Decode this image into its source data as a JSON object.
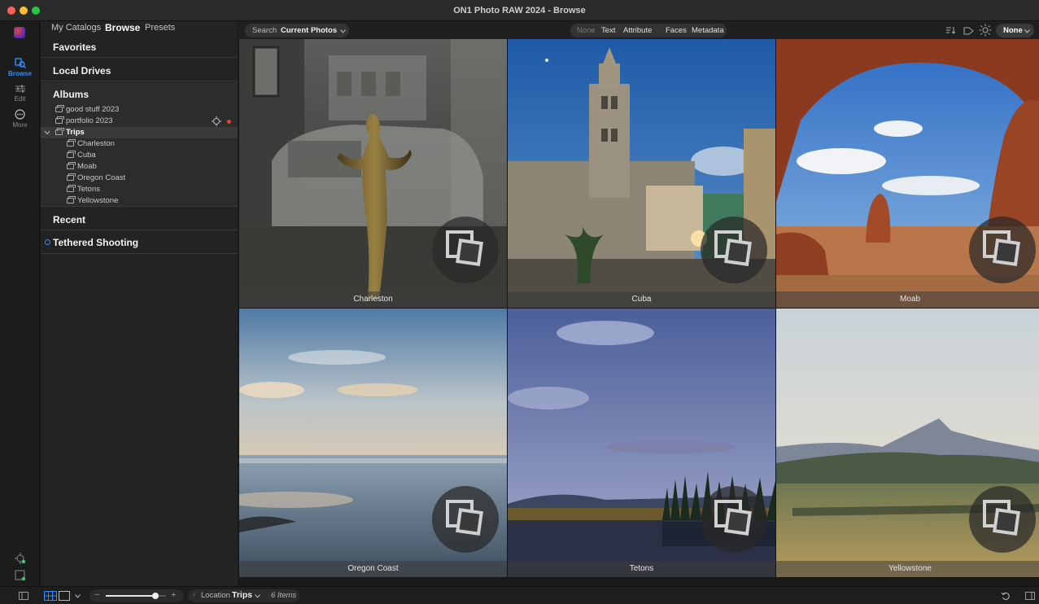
{
  "window": {
    "title": "ON1 Photo RAW 2024 - Browse",
    "traffic_colors": [
      "#ff5f57",
      "#febc2e",
      "#28c840"
    ]
  },
  "rail": {
    "items": [
      {
        "label": "Browse",
        "icon": "browse-icon",
        "active": true
      },
      {
        "label": "Edit",
        "icon": "sliders-icon",
        "active": false
      },
      {
        "label": "More",
        "icon": "more-icon",
        "active": false
      }
    ],
    "accent": "#2f8cff"
  },
  "panel": {
    "tabs": [
      "My Catalogs",
      "Browse",
      "Presets"
    ],
    "active_tab": "Browse",
    "sections": {
      "favorites": "Favorites",
      "local_drives": "Local Drives",
      "albums": "Albums",
      "recent": "Recent",
      "tethered": "Tethered Shooting"
    },
    "albums": [
      {
        "label": "good stuff 2023",
        "level": 0
      },
      {
        "label": "portfolio 2023",
        "level": 0
      },
      {
        "label": "Trips",
        "level": 0,
        "expanded": true
      },
      {
        "label": "Charleston",
        "level": 1
      },
      {
        "label": "Cuba",
        "level": 1
      },
      {
        "label": "Moab",
        "level": 1
      },
      {
        "label": "Oregon Coast",
        "level": 1
      },
      {
        "label": "Tetons",
        "level": 1
      },
      {
        "label": "Yellowstone",
        "level": 1
      }
    ]
  },
  "toolbar": {
    "search_prefix": "Search",
    "search_scope": "Current Photos",
    "filter_tabs": [
      "None",
      "Text",
      "Attribute",
      "Faces",
      "Metadata"
    ],
    "active_filter": "None",
    "sort_value": "None"
  },
  "grid": {
    "items": [
      {
        "caption": "Charleston"
      },
      {
        "caption": "Cuba"
      },
      {
        "caption": "Moab"
      },
      {
        "caption": "Oregon Coast"
      },
      {
        "caption": "Tetons"
      },
      {
        "caption": "Yellowstone"
      }
    ]
  },
  "statusbar": {
    "location_label": "Location",
    "location_value": "Trips",
    "item_count": "6 Items",
    "thumbnail_size": 0.82
  }
}
